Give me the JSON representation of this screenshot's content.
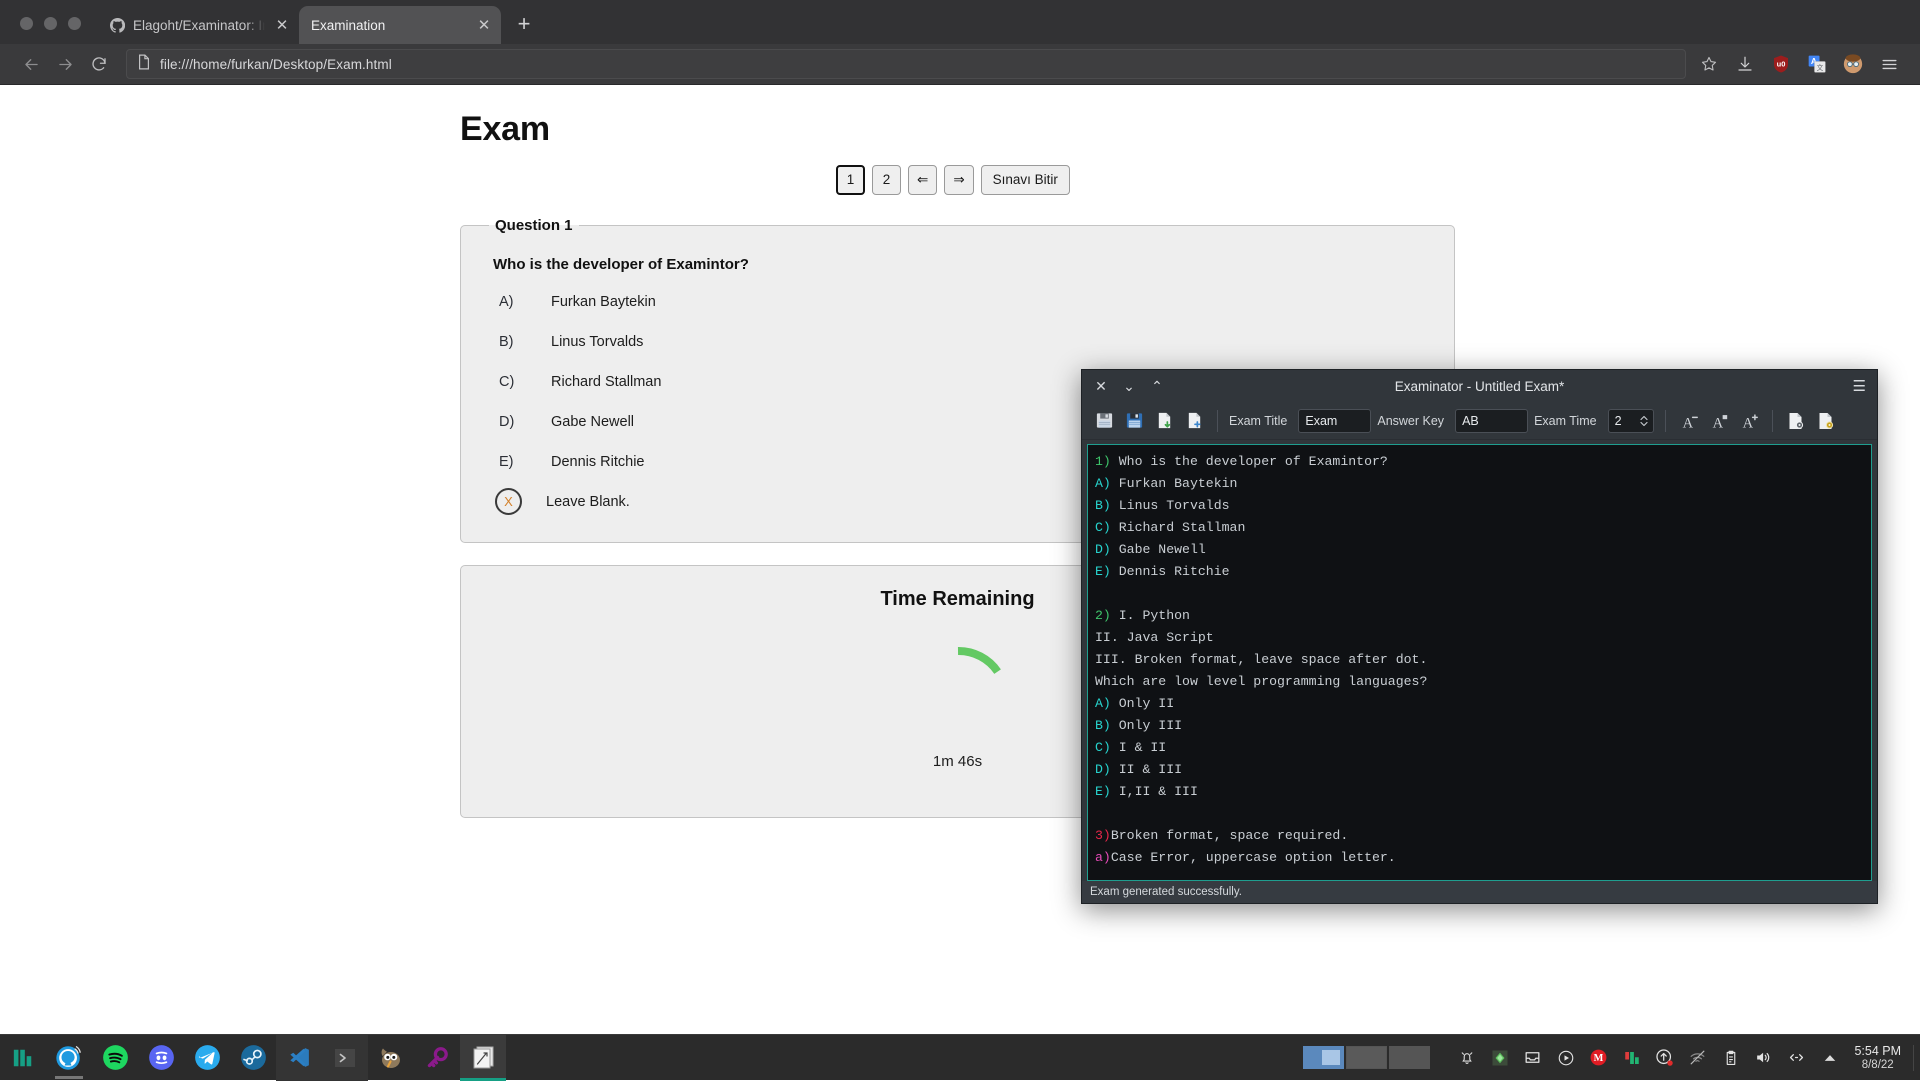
{
  "browser": {
    "window_controls": [
      "close",
      "minimize",
      "maximize"
    ],
    "tabs": [
      {
        "title": "Elagoht/Examinator: Intera",
        "favicon": "github-icon",
        "active": false
      },
      {
        "title": "Examination",
        "favicon": "none",
        "active": true
      }
    ],
    "new_tab_label": "+",
    "nav": {
      "back_label": "←",
      "forward_label": "→",
      "reload_label": "⟳",
      "url": "file:///home/furkan/Desktop/Exam.html",
      "page_icon": "document-icon",
      "bookmark_icon": "star-icon",
      "toolbar_icons": [
        "download-icon",
        "ublock-origin-icon",
        "google-translate-icon",
        "profile-avatar-icon",
        "hamburger-menu-icon"
      ]
    }
  },
  "exam_page": {
    "title": "Exam",
    "nav_buttons": [
      {
        "label": "1",
        "focused": true
      },
      {
        "label": "2",
        "focused": false
      },
      {
        "label": "⇐",
        "focused": false
      },
      {
        "label": "⇒",
        "focused": false
      },
      {
        "label": "Sınavı Bitir",
        "focused": false
      }
    ],
    "question": {
      "legend": "Question 1",
      "prompt": "Who is the developer of Examintor?",
      "options": [
        {
          "letter": "A)",
          "text": "Furkan Baytekin"
        },
        {
          "letter": "B)",
          "text": "Linus Torvalds"
        },
        {
          "letter": "C)",
          "text": "Richard Stallman"
        },
        {
          "letter": "D)",
          "text": "Gabe Newell"
        },
        {
          "letter": "E)",
          "text": "Dennis Ritchie"
        }
      ],
      "blank_option": {
        "mark": "X",
        "text": "Leave Blank."
      }
    },
    "timer": {
      "title": "Time Remaining",
      "value": "1m 46s",
      "arc_color": "#63c963",
      "progress_fraction": 0.12
    }
  },
  "examinator": {
    "title": "Examinator - Untitled Exam*",
    "window_controls": {
      "close": "✕",
      "minimize": "⌄",
      "maximize": "⌃"
    },
    "menu_icon": "hamburger-menu-icon",
    "toolbar": {
      "icons_left": [
        "save-icon",
        "save-as-icon",
        "import-document-icon",
        "new-document-icon"
      ],
      "exam_title_label": "Exam Title",
      "exam_title_value": "Exam",
      "answer_key_label": "Answer Key",
      "answer_key_value": "AB",
      "exam_time_label": "Exam Time",
      "exam_time_value": "2",
      "font_decrease_label": "A",
      "font_reset_label": "A",
      "font_increase_label": "A",
      "icons_right": [
        "generate-exam-icon",
        "generate-answer-key-icon"
      ]
    },
    "editor_lines": [
      {
        "marker": "1)",
        "marker_class": "ed-q",
        "text": " Who is the developer of Examintor?"
      },
      {
        "marker": "A)",
        "marker_class": "ed-opt",
        "text": " Furkan Baytekin"
      },
      {
        "marker": "B)",
        "marker_class": "ed-opt",
        "text": " Linus Torvalds"
      },
      {
        "marker": "C)",
        "marker_class": "ed-opt",
        "text": " Richard Stallman"
      },
      {
        "marker": "D)",
        "marker_class": "ed-opt",
        "text": " Gabe Newell"
      },
      {
        "marker": "E)",
        "marker_class": "ed-opt",
        "text": " Dennis Ritchie"
      },
      {
        "marker": "",
        "marker_class": "",
        "text": ""
      },
      {
        "marker": "2)",
        "marker_class": "ed-q",
        "text": " I. Python"
      },
      {
        "marker": "",
        "marker_class": "",
        "text": "II. Java Script"
      },
      {
        "marker": "",
        "marker_class": "",
        "text": "III. Broken format, leave space after dot."
      },
      {
        "marker": "",
        "marker_class": "",
        "text": "Which are low level programming languages?"
      },
      {
        "marker": "A)",
        "marker_class": "ed-opt",
        "text": " Only II"
      },
      {
        "marker": "B)",
        "marker_class": "ed-opt",
        "text": " Only III"
      },
      {
        "marker": "C)",
        "marker_class": "ed-opt",
        "text": " I & II"
      },
      {
        "marker": "D)",
        "marker_class": "ed-opt",
        "text": " II & III"
      },
      {
        "marker": "E)",
        "marker_class": "ed-opt",
        "text": " I,II & III"
      },
      {
        "marker": "",
        "marker_class": "",
        "text": ""
      },
      {
        "marker": "3)",
        "marker_class": "ed-err",
        "text": "Broken format, space required."
      },
      {
        "marker": "a)",
        "marker_class": "ed-case",
        "text": "Case Error, uppercase option letter."
      }
    ],
    "status": "Exam generated successfully."
  },
  "taskbar": {
    "launchers": [
      "manjaro-logo-icon",
      "web-browser-icon",
      "spotify-icon",
      "discord-icon",
      "telegram-icon",
      "steam-icon",
      "vscode-icon",
      "terminal-icon",
      "gimp-icon",
      "keepass-icon",
      "examinator-window-icon"
    ],
    "pagers": [
      {
        "active": true
      },
      {
        "active": false
      },
      {
        "active": false
      }
    ],
    "tray_icons": [
      "notifications-bell-icon",
      "night-color-icon",
      "archive-icon",
      "media-player-icon",
      "mailspring-icon",
      "manjaro-update-icon",
      "upload-status-icon",
      "network-icon",
      "clipboard-icon",
      "volume-icon",
      "connection-icon",
      "show-hidden-icons-arrow"
    ],
    "clock_time": "5:54 PM",
    "clock_date": "8/8/22"
  }
}
